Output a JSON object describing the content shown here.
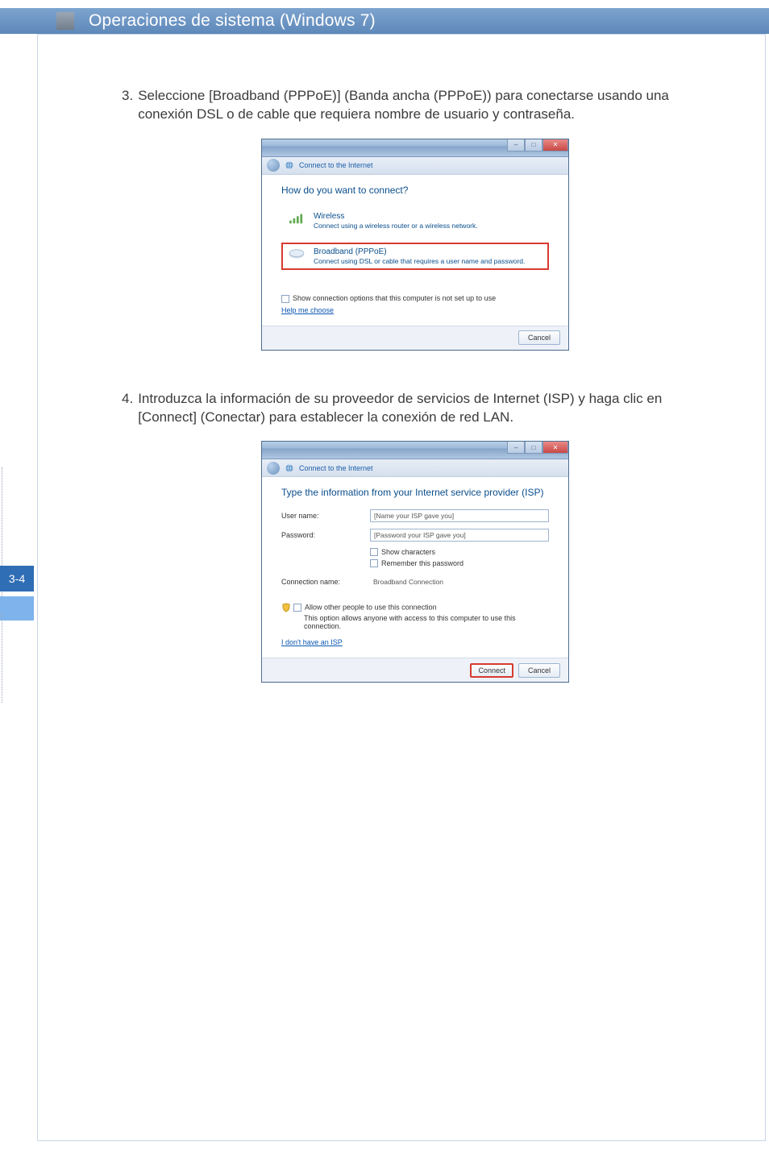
{
  "header": {
    "title": "Operaciones de sistema (Windows 7)"
  },
  "pagenum": "3-4",
  "steps": [
    {
      "num": "3.",
      "text": "Seleccione [Broadband (PPPoE)] (Banda ancha (PPPoE)) para conectarse usando una conexión DSL o de cable que requiera nombre de usuario y contraseña."
    },
    {
      "num": "4.",
      "text": "Introduzca la información de su proveedor de servicios de Internet (ISP) y haga clic en [Connect] (Conectar) para establecer la conexión de red LAN."
    }
  ],
  "dialog1": {
    "breadcrumb": "Connect to the Internet",
    "heading": "How do you want to connect?",
    "options": [
      {
        "title": "Wireless",
        "desc": "Connect using a wireless router or a wireless network."
      },
      {
        "title": "Broadband (PPPoE)",
        "desc": "Connect using DSL or cable that requires a user name and password."
      }
    ],
    "checkbox": "Show connection options that this computer is not set up to use",
    "helplink": "Help me choose",
    "cancel": "Cancel"
  },
  "dialog2": {
    "breadcrumb": "Connect to the Internet",
    "heading": "Type the information from your Internet service provider (ISP)",
    "username_label": "User name:",
    "username_value": "[Name your ISP gave you]",
    "password_label": "Password:",
    "password_value": "[Password your ISP gave you]",
    "showchars": "Show characters",
    "remember": "Remember this password",
    "connname_label": "Connection name:",
    "connname_value": "Broadband Connection",
    "allow": "Allow other people to use this connection",
    "allow_desc": "This option allows anyone with access to this computer to use this connection.",
    "noISP": "I don't have an ISP",
    "connect": "Connect",
    "cancel": "Cancel"
  }
}
